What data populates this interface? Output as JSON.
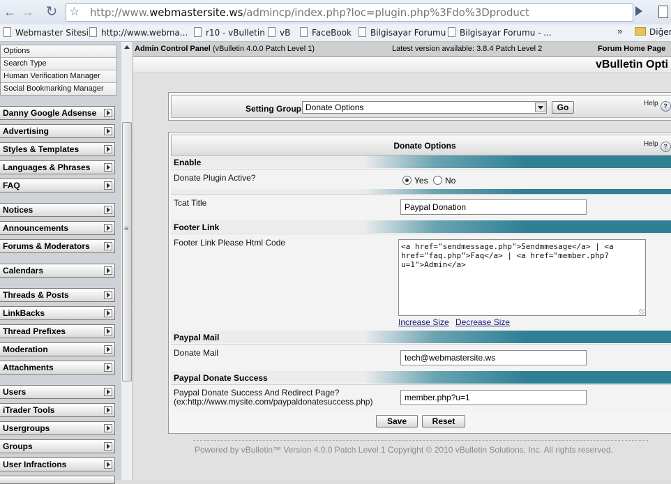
{
  "browser": {
    "url_prefix": "http://www.",
    "url_domain": "webmastersite.ws",
    "url_path": "/admincp/index.php?loc=plugin.php%3Fdo%3Dproduct",
    "back_glyph": "←",
    "forward_glyph": "→",
    "reload_glyph": "↻",
    "star_glyph": "☆",
    "bookmarks": [
      "Webmaster Sitesi",
      "http://www.webma...",
      "r10 - vBulletin",
      "vB",
      "FaceBook",
      "Bilgisayar Forumu",
      "Bilgisayar Forumu - ..."
    ],
    "bookmarks_overflow": "»",
    "other_bookmarks": "Diğer"
  },
  "sidebar": {
    "subitems": [
      "Options",
      "Search Type",
      "Human Verification Manager",
      "Social Bookmarking Manager"
    ],
    "groups": [
      "Danny Google Adsense",
      "Advertising",
      "Styles & Templates",
      "Languages & Phrases",
      "FAQ",
      "Notices",
      "Announcements",
      "Forums & Moderators",
      "Calendars",
      "Threads & Posts",
      "LinkBacks",
      "Thread Prefixes",
      "Moderation",
      "Attachments",
      "Users",
      "iTrader Tools",
      "Usergroups",
      "Groups",
      "User Infractions"
    ]
  },
  "header": {
    "title": "Admin Control Panel",
    "version": "(vBulletin 4.0.0 Patch Level 1)",
    "latest": "Latest version available: 3.8.4 Patch Level 2",
    "home_link": "Forum Home Page",
    "page_title": "vBulletin Opti"
  },
  "setting_group": {
    "label": "Setting Group",
    "selected": "Donate Options",
    "go": "Go",
    "help": "Help"
  },
  "donate": {
    "title": "Donate Options",
    "help": "Help",
    "enable_heading": "Enable",
    "active_label": "Donate Plugin Active?",
    "yes": "Yes",
    "no": "No",
    "tcat_label": "Tcat Title",
    "tcat_value": "Paypal Donation",
    "footer_heading": "Footer Link",
    "footer_label": "Footer Link Please Html Code",
    "footer_value": "<a href=\"sendmessage.php\">Sendmmesage</a> | <a href=\"faq.php\">Faq</a> | <a href=\"member.php?u=1\">Admin</a>",
    "increase": "Increase Size",
    "decrease": "Decrease Size",
    "mail_heading": "Paypal Mail",
    "mail_label": "Donate Mail",
    "mail_value": "tech@webmastersite.ws",
    "success_heading": "Paypal Donate Success",
    "success_label_1": "Paypal Donate Success And Redirect Page?",
    "success_label_2": "(ex:http://www.mysite.com/paypaldonatesuccess.php)",
    "success_value": "member.php?u=1",
    "save": "Save",
    "reset": "Reset"
  },
  "footer": "Powered by vBulletin™ Version 4.0.0 Patch Level 1 Copyright © 2010 vBulletin Solutions, Inc. All rights reserved."
}
